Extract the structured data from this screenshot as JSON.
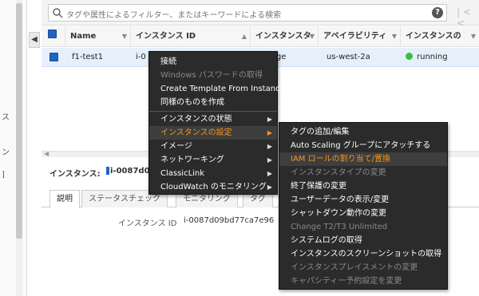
{
  "left_panel": {
    "fragments": [
      "ス",
      "ン",
      "]"
    ]
  },
  "filter": {
    "placeholder": "タグや属性によるフィルター、またはキーワードによる検索",
    "help_label": "?",
    "pager": "|< <"
  },
  "table": {
    "columns": [
      "Name",
      "インスタンス ID",
      "インスタンスタ",
      "アベイラビリティ",
      "インスタンスの"
    ],
    "row": {
      "name": "f1-test1",
      "id_fragment": "i-0",
      "type_fragment": "rge",
      "az": "us-west-2a",
      "state": "running"
    }
  },
  "instance_bar": {
    "label": "インスタンス:",
    "id": "i-0087d09b"
  },
  "tabs": [
    "説明",
    "ステータスチェック",
    "モニタリング",
    "タグ"
  ],
  "detail": {
    "label": "インスタンス ID",
    "value": "i-0087d09bd77ca7e96"
  },
  "main_menu": {
    "items": [
      {
        "label": "接続",
        "disabled": false,
        "submenu": false
      },
      {
        "label": "Windows パスワードの取得",
        "disabled": true,
        "submenu": false
      },
      {
        "label": "Create Template From Instance",
        "disabled": false,
        "submenu": false
      },
      {
        "label": "同様のものを作成",
        "disabled": false,
        "submenu": false
      },
      {
        "label": "インスタンスの状態",
        "disabled": false,
        "submenu": true
      },
      {
        "label": "インスタンスの設定",
        "disabled": false,
        "submenu": true,
        "highlight": true
      },
      {
        "label": "イメージ",
        "disabled": false,
        "submenu": true
      },
      {
        "label": "ネットワーキング",
        "disabled": false,
        "submenu": true
      },
      {
        "label": "ClassicLink",
        "disabled": false,
        "submenu": true
      },
      {
        "label": "CloudWatch のモニタリング",
        "disabled": false,
        "submenu": true
      }
    ]
  },
  "sub_menu": {
    "items": [
      {
        "label": "タグの追加/編集",
        "disabled": false
      },
      {
        "label": "Auto Scaling グループにアタッチする",
        "disabled": false
      },
      {
        "label": "IAM ロールの割り当て/置換",
        "disabled": false,
        "highlight": true
      },
      {
        "label": "インスタンスタイプの変更",
        "disabled": true
      },
      {
        "label": "終了保護の変更",
        "disabled": false
      },
      {
        "label": "ユーザーデータの表示/変更",
        "disabled": false
      },
      {
        "label": "シャットダウン動作の変更",
        "disabled": false
      },
      {
        "label": "Change T2/T3 Unlimited",
        "disabled": true
      },
      {
        "label": "システムログの取得",
        "disabled": false
      },
      {
        "label": "インスタンスのスクリーンショットの取得",
        "disabled": false
      },
      {
        "label": "インスタンスプレイスメントの変更",
        "disabled": true
      },
      {
        "label": "キャパシティー予約設定を変更",
        "disabled": true
      }
    ]
  },
  "colors": {
    "accent": "#1f66c3",
    "highlight": "#f7961d",
    "menu_bg": "#2b2b2b",
    "running": "#3dbd3d"
  }
}
